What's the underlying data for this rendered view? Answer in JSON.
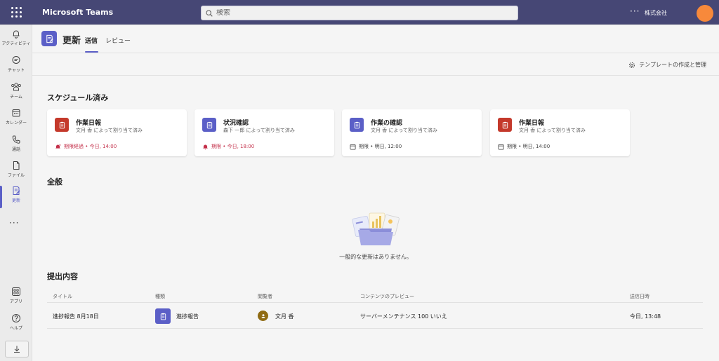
{
  "topbar": {
    "app_title": "Microsoft Teams",
    "search_placeholder": "検索",
    "more": "···",
    "org_name": "株式会社",
    "accent": "#464775",
    "avatar_color": "#f7893b"
  },
  "rail": {
    "items": [
      {
        "label": "アクティビティ",
        "icon": "bell-icon"
      },
      {
        "label": "チャット",
        "icon": "chat-icon"
      },
      {
        "label": "チーム",
        "icon": "teams-icon"
      },
      {
        "label": "カレンダー",
        "icon": "calendar-icon"
      },
      {
        "label": "通話",
        "icon": "phone-icon"
      },
      {
        "label": "ファイル",
        "icon": "file-icon"
      },
      {
        "label": "更新",
        "icon": "updates-icon",
        "active": true
      }
    ],
    "more": "···",
    "bottom_items": [
      {
        "label": "アプリ",
        "icon": "apps-icon"
      },
      {
        "label": "ヘルプ",
        "icon": "help-icon"
      }
    ],
    "download_icon": "download-icon"
  },
  "header": {
    "title": "更新",
    "tabs": [
      {
        "label": "送信",
        "active": true
      },
      {
        "label": "レビュー",
        "active": false
      }
    ]
  },
  "subbar": {
    "manage_label": "テンプレートの作成と管理"
  },
  "scheduled": {
    "title": "スケジュール済み",
    "cards": [
      {
        "title": "作業日報",
        "subtitle": "文月 香 によって割り当て済み",
        "due": "期限経過 • 今日, 14:00",
        "due_style": "red-overdue",
        "icon_color": "#c4392b"
      },
      {
        "title": "状況確認",
        "subtitle": "森下 一郎 によって割り当て済み",
        "due": "期限 • 今日, 18:00",
        "due_style": "red-bell",
        "icon_color": "#5b5fc7"
      },
      {
        "title": "作業の確認",
        "subtitle": "文月 香 によって割り当て済み",
        "due": "期限 • 明日, 12:00",
        "due_style": "gray",
        "icon_color": "#5b5fc7"
      },
      {
        "title": "作業日報",
        "subtitle": "文月 香 によって割り当て済み",
        "due": "期限 • 明日, 14:00",
        "due_style": "gray",
        "icon_color": "#c4392b"
      }
    ]
  },
  "general": {
    "title": "全般",
    "empty_text": "一般的な更新はありません。"
  },
  "submissions": {
    "title": "提出内容",
    "columns": [
      "タイトル",
      "種類",
      "閲覧者",
      "コンテンツのプレビュー",
      "送信日時"
    ],
    "rows": [
      {
        "title": "進捗報告 8月18日",
        "type": "進捗報告",
        "viewer": "文月 香",
        "preview": "サーバーメンテナンス 100 いいえ",
        "sent": "今日, 13:48"
      }
    ]
  }
}
